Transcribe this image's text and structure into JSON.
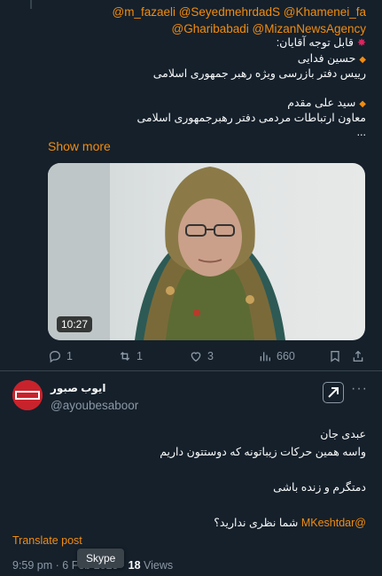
{
  "tweet1": {
    "mentions_line1": "@m_fazaeli @SeyedmehrdadS @Khamenei_fa",
    "mentions_line2": "@Gharibabadi @MizanNewsAgency",
    "attention": "قابل توجه آقایان:",
    "person1_name": "حسین فدایی",
    "person1_title": "رییس دفتر بازرسی ویژه رهبر جمهوری اسلامی",
    "person2_name": "سید علی مقدم",
    "person2_title": "معاون ارتباطات مردمی دفتر رهبرجمهوری اسلامی",
    "ellipsis": "...",
    "show_more": "Show more",
    "video_duration": "10:27",
    "stats": {
      "replies": "1",
      "retweets": "1",
      "likes": "3",
      "views": "660"
    }
  },
  "tweet2": {
    "display_name": "ایوب صبور",
    "handle": "@ayoubesaboor",
    "line1": "عبدی جان",
    "line2": "واسه همین حرکات زیباتونه که دوستتون داریم",
    "line3": "دمتگرم و زنده باشی",
    "mention": "@MKeshtdar",
    "line4": "شما نظری ندارید؟",
    "translate": "Translate post",
    "time": "9:59 pm · 6 Feb 2025 · ",
    "views_count": "18",
    "views_label": " Views"
  },
  "tooltip": "Skype",
  "colors": {
    "accent": "#f28c0f",
    "background": "#15202b",
    "muted": "#8b98a5"
  },
  "icons": [
    "reply-icon",
    "retweet-icon",
    "like-icon",
    "views-icon",
    "bookmark-icon",
    "share-icon",
    "grok-icon",
    "more-icon"
  ]
}
